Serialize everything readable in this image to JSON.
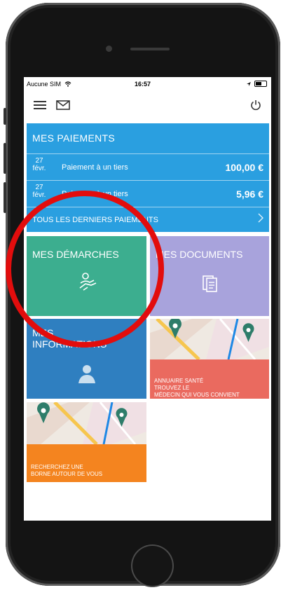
{
  "status": {
    "carrier": "Aucune SIM",
    "time": "16:57"
  },
  "icons": {
    "wifi": "wifi-icon",
    "location": "location-arrow-icon",
    "battery": "battery-icon",
    "menu": "hamburger-menu-icon",
    "mail": "envelope-icon",
    "power": "power-icon",
    "chevron": "chevron-right-icon",
    "demarches": "person-hand-icon",
    "documents": "documents-icon",
    "infos": "person-bust-icon"
  },
  "payments": {
    "title": "MES PAIEMENTS",
    "rows": [
      {
        "day": "27",
        "month": "févr.",
        "label": "Paiement à un tiers",
        "amount": "100,00 €"
      },
      {
        "day": "27",
        "month": "févr.",
        "label": "Paiement à un tiers",
        "amount": "5,96 €"
      }
    ],
    "all_label": "TOUS LES DERNIERS PAIEMENTS"
  },
  "tiles": {
    "demarches": "MES DÉMARCHES",
    "documents": "MES DOCUMENTS",
    "infos_line1": "MES",
    "infos_line2": "INFORMATIONS",
    "annuaire_line1": "ANNUAIRE SANTÉ",
    "annuaire_line2": "TROUVEZ LE",
    "annuaire_line3": "MÉDECIN QUI VOUS CONVIENT",
    "borne_line1": "RECHERCHEZ UNE",
    "borne_line2": "BORNE AUTOUR DE VOUS"
  },
  "colors": {
    "payments": "#2a9fe0",
    "demarches": "#3cae8f",
    "documents": "#a8a3dc",
    "infos": "#2f7fc0",
    "annuaire": "#ea6a5f",
    "borne": "#f4841f",
    "highlight_ring": "#e20d0d"
  }
}
